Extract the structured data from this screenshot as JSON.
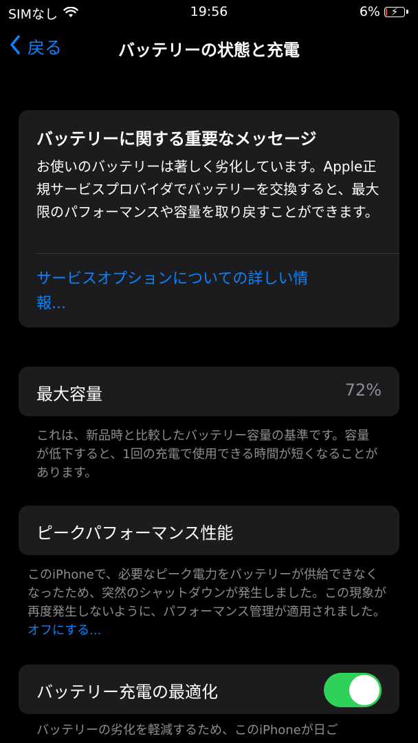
{
  "status": {
    "carrier": "SIMなし",
    "time": "19:56",
    "battery_percent": "6%",
    "battery_level": 0.06,
    "icons": [
      "wifi-icon",
      "battery-charging-icon"
    ]
  },
  "nav": {
    "back_label": "戻る",
    "title": "バッテリーの状態と充電"
  },
  "message": {
    "title": "バッテリーに関する重要なメッセージ",
    "body": "お使いのバッテリーは著しく劣化しています。Apple正規サービスプロバイダでバッテリーを交換すると、最大限のパフォーマンスや容量を取り戻すことができます。",
    "link": "サービスオプションについての詳しい情報..."
  },
  "capacity": {
    "label": "最大容量",
    "value": "72%",
    "footnote": "これは、新品時と比較したバッテリー容量の基準です。容量が低下すると、1回の充電で使用できる時間が短くなることがあります。"
  },
  "peak": {
    "label": "ピークパフォーマンス性能",
    "footnote": "このiPhoneで、必要なピーク電力をバッテリーが供給できなくなったため、突然のシャットダウンが発生しました。この現象が再度発生しないように、パフォーマンス管理が適用されました。",
    "footnote_link": "オフにする..."
  },
  "optimize": {
    "label": "バッテリー充電の最適化",
    "toggle_on": true,
    "footnote": "バッテリーの劣化を軽減するため、このiPhoneが日ご"
  },
  "colors": {
    "background": "#000000",
    "card": "#1c1c1e",
    "accent": "#0a84ff",
    "secondary_text": "#8e8e93",
    "toggle_on": "#30d158",
    "battery_low": "#ff3b30"
  }
}
